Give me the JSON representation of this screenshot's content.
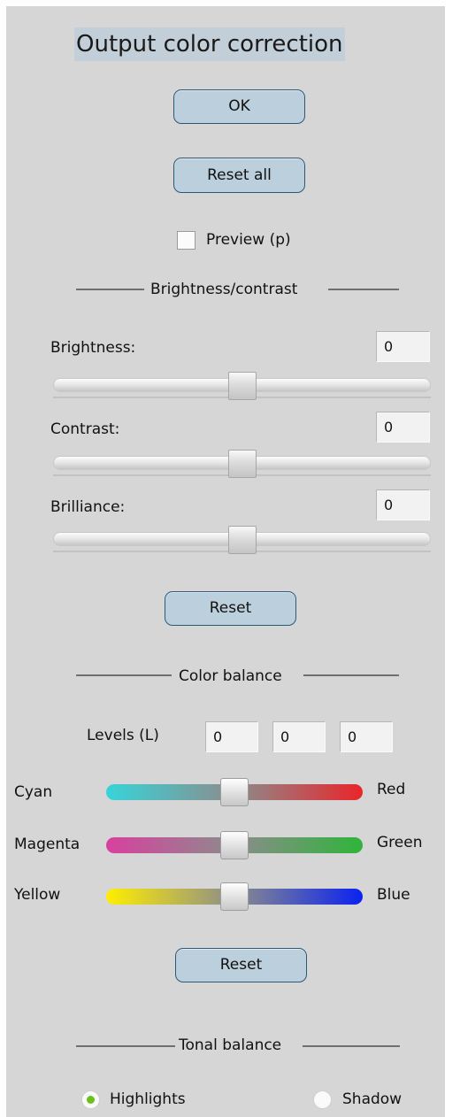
{
  "dialog": {
    "title": "Output color correction",
    "ok_label": "OK",
    "reset_all_label": "Reset all",
    "preview": {
      "label": "Preview (p)",
      "checked": false
    }
  },
  "brightness_contrast": {
    "section_label": "Brightness/contrast",
    "brightness": {
      "label": "Brightness:",
      "value": "0",
      "slider_fraction": 0.5
    },
    "contrast": {
      "label": "Contrast:",
      "value": "0",
      "slider_fraction": 0.5
    },
    "brilliance": {
      "label": "Brilliance:",
      "value": "0",
      "slider_fraction": 0.5
    },
    "reset_label": "Reset"
  },
  "color_balance": {
    "section_label": "Color balance",
    "levels_label": "Levels (L)",
    "levels": [
      "0",
      "0",
      "0"
    ],
    "sliders": [
      {
        "left": "Cyan",
        "right": "Red",
        "left_color": "#37d4d9",
        "right_color": "#e8262a",
        "fraction": 0.5
      },
      {
        "left": "Magenta",
        "right": "Green",
        "left_color": "#d8409e",
        "right_color": "#2fb43a",
        "fraction": 0.5
      },
      {
        "left": "Yellow",
        "right": "Blue",
        "left_color": "#ffee00",
        "right_color": "#0a23f0",
        "fraction": 0.5
      }
    ],
    "reset_label": "Reset"
  },
  "tonal_balance": {
    "section_label": "Tonal balance",
    "highlights_label": "Highlights",
    "shadow_label": "Shadow",
    "selected": "Highlights",
    "radio_color": "#6cc01a"
  }
}
